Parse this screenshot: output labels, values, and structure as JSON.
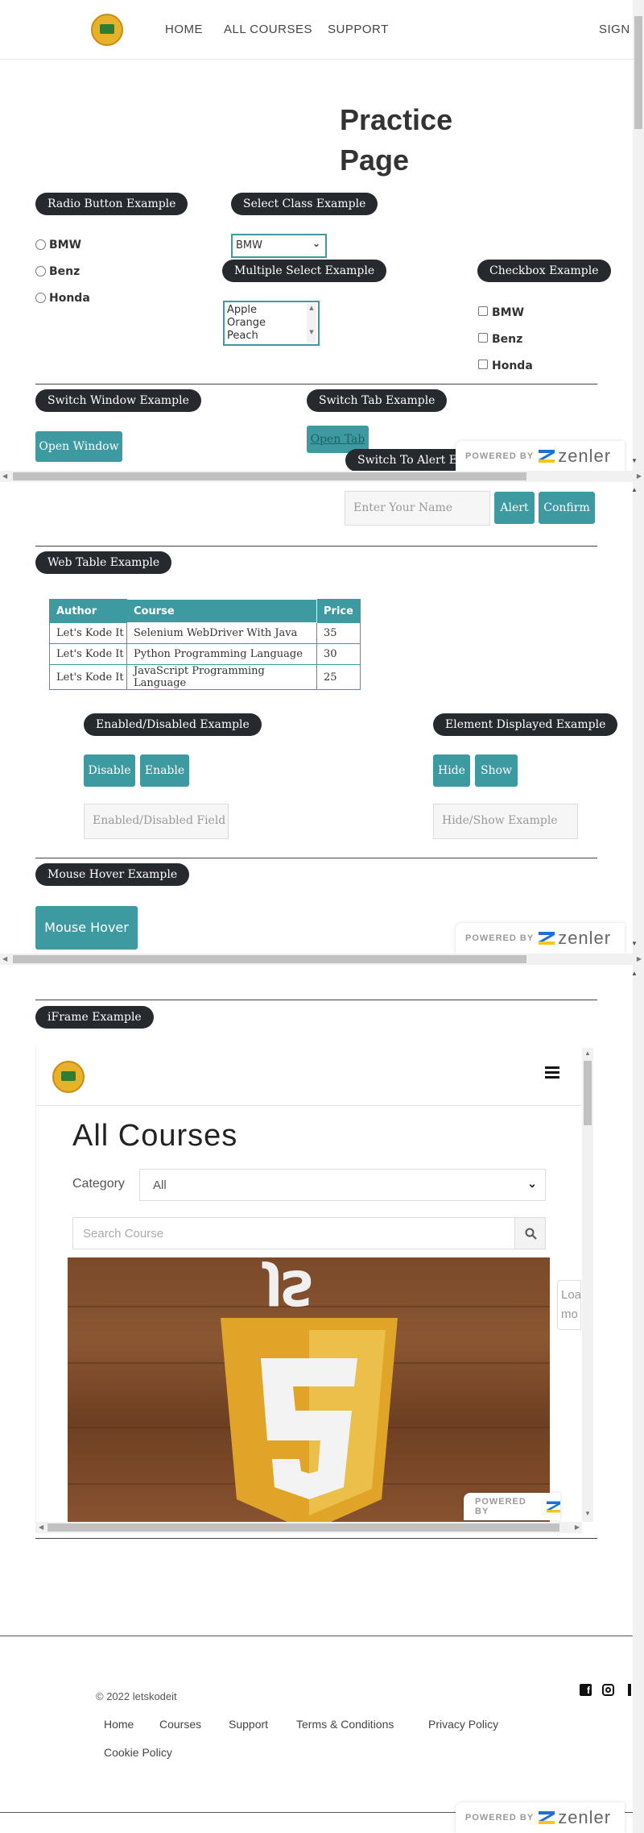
{
  "nav": {
    "home": "HOME",
    "courses": "ALL COURSES",
    "support": "SUPPORT",
    "sign": "SIGN"
  },
  "page_title_line1": "Practice",
  "page_title_line2": "Page",
  "radio": {
    "title": "Radio Button Example",
    "options": [
      "BMW",
      "Benz",
      "Honda"
    ]
  },
  "select": {
    "title": "Select Class Example",
    "value": "BMW"
  },
  "multi": {
    "title": "Multiple Select Example",
    "options": [
      "Apple",
      "Orange",
      "Peach"
    ]
  },
  "checkbox": {
    "title": "Checkbox Example",
    "options": [
      "BMW",
      "Benz",
      "Honda"
    ]
  },
  "window": {
    "title": "Switch Window Example",
    "button": "Open Window"
  },
  "tab": {
    "title": "Switch Tab Example",
    "button": "Open Tab"
  },
  "alert": {
    "title": "Switch To Alert Exa",
    "placeholder": "Enter Your Name",
    "alert_btn": "Alert",
    "confirm_btn": "Confirm"
  },
  "zenler": {
    "powered": "POWERED BY",
    "word": "zenler"
  },
  "webtable": {
    "title": "Web Table Example",
    "headers": [
      "Author",
      "Course",
      "Price"
    ],
    "rows": [
      [
        "Let's Kode It",
        "Selenium WebDriver With Java",
        "35"
      ],
      [
        "Let's Kode It",
        "Python Programming Language",
        "30"
      ],
      [
        "Let's Kode It",
        "JavaScript Programming Language",
        "25"
      ]
    ]
  },
  "enabled": {
    "title": "Enabled/Disabled Example",
    "disable": "Disable",
    "enable": "Enable",
    "placeholder": "Enabled/Disabled Field"
  },
  "displayed": {
    "title": "Element Displayed Example",
    "hide": "Hide",
    "show": "Show",
    "placeholder": "Hide/Show Example"
  },
  "hover": {
    "title": "Mouse Hover Example",
    "button": "Mouse Hover"
  },
  "iframe": {
    "title": "iFrame Example",
    "heading": "All Courses",
    "category_label": "Category",
    "category_value": "All",
    "search_placeholder": "Search Course",
    "side_text1": "Loa",
    "side_text2": "mo",
    "powered": "POWERED BY"
  },
  "footer": {
    "copyright": "© 2022 letskodeit",
    "links": [
      "Home",
      "Courses",
      "Support",
      "Terms & Conditions",
      "Privacy Policy"
    ],
    "cookie": "Cookie Policy"
  },
  "colors": {
    "accent": "#3d9aa1",
    "pill": "#262a2e",
    "zenler_blue": "#1e6fd9",
    "zenler_yellow": "#f5c518"
  }
}
